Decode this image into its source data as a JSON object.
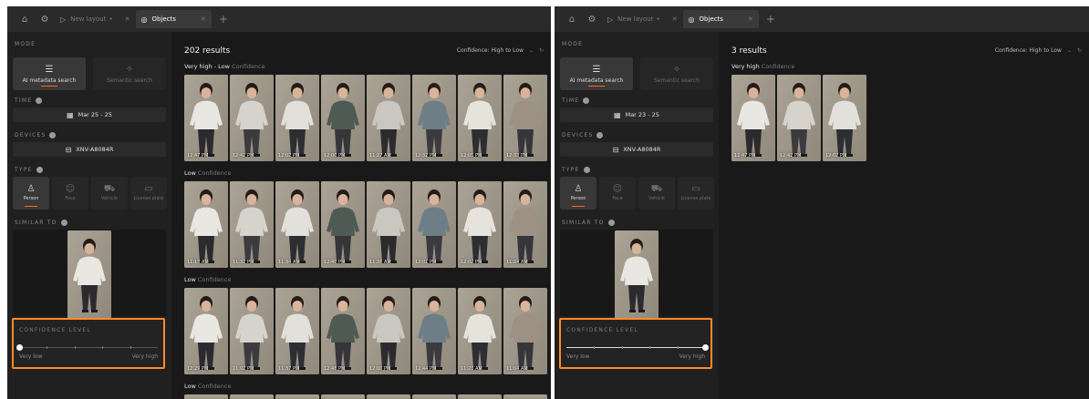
{
  "panel_a": {
    "tabs": [
      {
        "label": "New layout",
        "icon": "play-icon",
        "modified": "•"
      },
      {
        "label": "Objects",
        "icon": "objects-icon"
      }
    ],
    "sidebar": {
      "mode_title": "MODE",
      "mode_ai": "AI metadata search",
      "mode_semantic": "Semantic search",
      "time_title": "TIME",
      "date_range": "Mar 25 - 25",
      "devices_title": "DEVICES",
      "device": "XNV-A8084R",
      "type_title": "TYPE",
      "types": [
        "Person",
        "Face",
        "Vehicle",
        "License plate"
      ],
      "similar_title": "SIMILAR TO",
      "confidence_title": "CONFIDENCE LEVEL",
      "confidence_low": "Very low",
      "confidence_high": "Very high",
      "confidence_value": 0
    },
    "results_count": "202 results",
    "sort_label": "Confidence: High to Low",
    "groups": [
      {
        "label": "Very high - Low",
        "suffix": "Confidence",
        "times": [
          "12:47 PM",
          "12:42 PM",
          "12:02 PM",
          "12:00 PM",
          "11:27 AM",
          "12:32 PM",
          "12:05 PM",
          "12:33 PM"
        ]
      },
      {
        "label": "Low",
        "suffix": "Confidence",
        "times": [
          "11:13 AM",
          "11:32 PM",
          "11:34 AM",
          "12:40 PM",
          "11:36 AM",
          "12:01 PM",
          "12:02 PM",
          "11:24 AM"
        ]
      },
      {
        "label": "Low",
        "suffix": "Confidence",
        "times": [
          "12:29 PM",
          "11:02 PM",
          "11:37 PM",
          "12:48 PM",
          "12:00 PM",
          "12:44 PM",
          "11:23 AM",
          "11:04 AM"
        ]
      },
      {
        "label": "Low",
        "suffix": "Confidence",
        "times": []
      }
    ]
  },
  "panel_b": {
    "tabs": [
      {
        "label": "New layout",
        "icon": "play-icon",
        "modified": "•"
      },
      {
        "label": "Objects",
        "icon": "objects-icon"
      }
    ],
    "sidebar": {
      "mode_title": "MODE",
      "mode_ai": "AI metadata search",
      "mode_semantic": "Semantic search",
      "time_title": "TIME",
      "date_range": "Mar 23 - 25",
      "devices_title": "DEVICES",
      "device": "XNV-A8084R",
      "type_title": "TYPE",
      "types": [
        "Person",
        "Face",
        "Vehicle",
        "License plate"
      ],
      "similar_title": "SIMILAR TO",
      "confidence_title": "CONFIDENCE LEVEL",
      "confidence_low": "Very low",
      "confidence_high": "Very high",
      "confidence_value": 1
    },
    "results_count": "3 results",
    "sort_label": "Confidence: High to Low",
    "groups": [
      {
        "label": "Very high",
        "suffix": "Confidence",
        "times": [
          "12:47 PM",
          "12:42 PM",
          "12:02 PM"
        ]
      }
    ]
  },
  "theme": {
    "accent": "#ff6a1a",
    "highlight_border": "#ff8a2a"
  },
  "icons": {
    "home": "home-icon",
    "settings": "gear-icon",
    "sort_menu": "chevron-down-icon",
    "refresh": "refresh-icon"
  }
}
